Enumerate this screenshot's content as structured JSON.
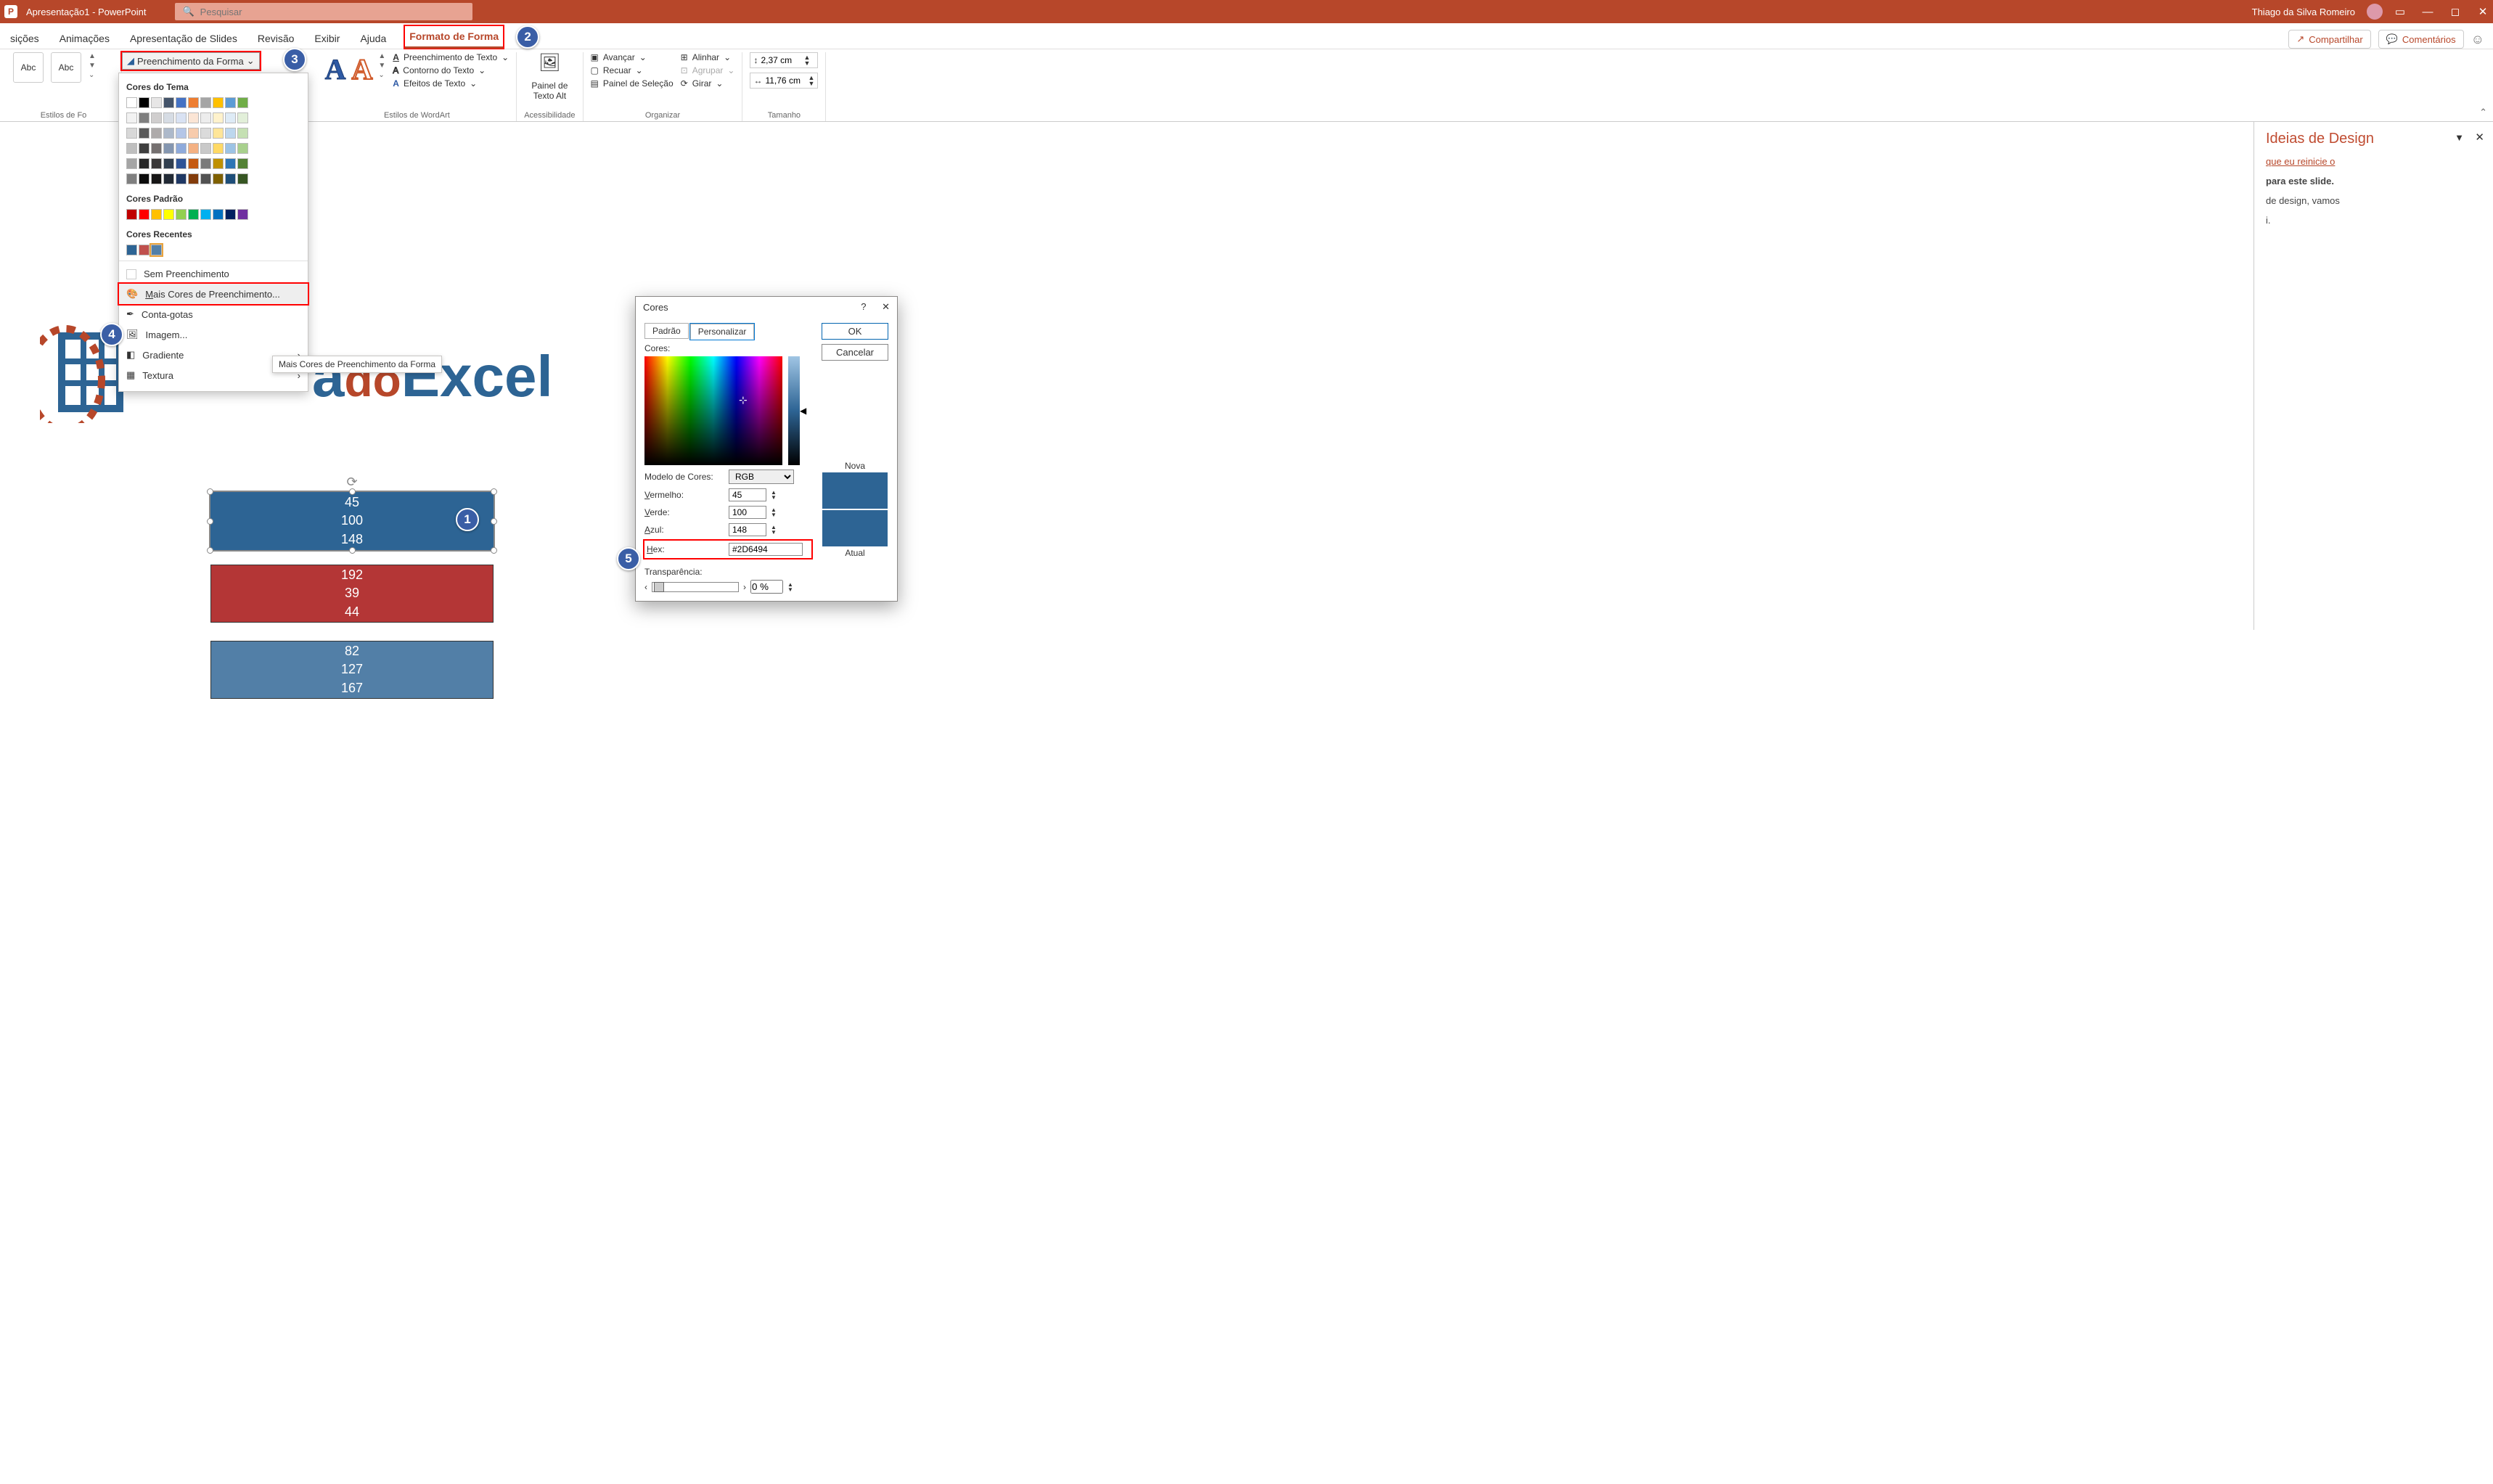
{
  "title_bar": {
    "doc_title": "Apresentação1 - PowerPoint",
    "search_placeholder": "Pesquisar",
    "user_name": "Thiago da Silva Romeiro"
  },
  "tabs": {
    "t0": "sições",
    "t1": "Animações",
    "t2": "Apresentação de Slides",
    "t3": "Revisão",
    "t4": "Exibir",
    "t5": "Ajuda",
    "t6": "Formato de Forma",
    "share": "Compartilhar",
    "comments": "Comentários"
  },
  "ribbon": {
    "abc": "Abc",
    "fill_btn": "Preenchimento da Forma",
    "styles_group": "Estilos de Fo",
    "txt_fill": "Preenchimento de Texto",
    "txt_outline": "Contorno do Texto",
    "txt_effects": "Efeitos de Texto",
    "wordart_group": "Estilos de WordArt",
    "alt_text": "Painel de Texto Alt",
    "acc_group": "Acessibilidade",
    "forward": "Avançar",
    "backward": "Recuar",
    "sel_pane": "Painel de Seleção",
    "align": "Alinhar",
    "group": "Agrupar",
    "rotate": "Girar",
    "arrange_group": "Organizar",
    "height_val": "2,37 cm",
    "width_val": "11,76 cm",
    "size_group": "Tamanho"
  },
  "fill_menu": {
    "theme_colors": "Cores do Tema",
    "standard_colors": "Cores Padrão",
    "recent_colors": "Cores Recentes",
    "no_fill": "Sem Preenchimento",
    "more_colors": "Mais Cores de Preenchimento...",
    "eyedropper": "Conta-gotas",
    "picture": "Imagem...",
    "gradient": "Gradiente",
    "texture": "Textura",
    "tooltip": "Mais Cores de Preenchimento da Forma"
  },
  "slide": {
    "logo1": "a",
    "logo2": "do",
    "logo3": "Excel",
    "shape1": {
      "v1": "45",
      "v2": "100",
      "v3": "148"
    },
    "shape2": {
      "v1": "192",
      "v2": "39",
      "v3": "44"
    },
    "shape3": {
      "v1": "82",
      "v2": "127",
      "v3": "167"
    }
  },
  "design_pane": {
    "title": "Ideias de Design",
    "link": "que eu reinicie o",
    "bold_line": "para este slide.",
    "line2": "de design, vamos",
    "line3": "i."
  },
  "dialog": {
    "title": "Cores",
    "tab_std": "Padrão",
    "tab_cust": "Personalizar",
    "colors_lbl": "Cores:",
    "model_lbl": "Modelo de Cores:",
    "model_val": "RGB",
    "red_u": "V",
    "red_lbl": "ermelho:",
    "red_val": "45",
    "green_u": "V",
    "green_lbl": "erde:",
    "green_val": "100",
    "blue_u": "A",
    "blue_lbl": "zul:",
    "blue_val": "148",
    "hex_u": "H",
    "hex_lbl": "ex:",
    "hex_val": "#2D6494",
    "transp_u": "T",
    "transp_lbl": "ransparência:",
    "transp_val": "0 %",
    "ok": "OK",
    "cancel": "Cancelar",
    "new": "Nova",
    "current": "Atual"
  },
  "badges": {
    "b1": "1",
    "b2": "2",
    "b3": "3",
    "b4": "4",
    "b5": "5"
  }
}
